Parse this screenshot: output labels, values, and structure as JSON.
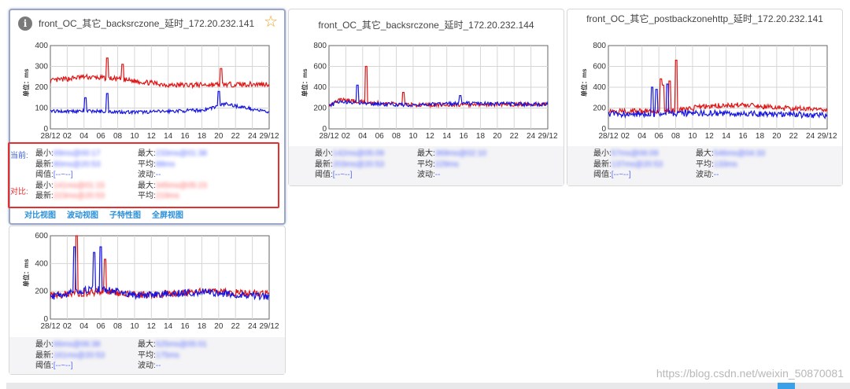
{
  "cards": [
    {
      "title": "front_OC_其它_backsrczone_延时_172.20.232.141",
      "has_info_icon": true,
      "has_star_icon": true,
      "active": true,
      "yaxis_label": "单位：ms",
      "yticks": [
        "400",
        "300",
        "200",
        "100",
        "0"
      ],
      "ymax": 400,
      "xticks": [
        "28/12",
        "02",
        "04",
        "06",
        "08",
        "10",
        "12",
        "14",
        "16",
        "18",
        "20",
        "22",
        "24",
        "29/12"
      ],
      "current_tag": "当前:",
      "compare_tag": "对比:",
      "rows": [
        {
          "l": "最小:",
          "lv": "69ms@00:17",
          "r": "最大:",
          "rv": "233ms@01:38",
          "color": "blue"
        },
        {
          "l": "最新:",
          "lv": "80ms@20:53",
          "r": "平均:",
          "rv": "88ms",
          "color": "blue"
        },
        {
          "l": "阈值:",
          "lv": "[--~--]",
          "r": "波动:",
          "rv": "--",
          "color": "plain"
        },
        {
          "l": "最小:",
          "lv": "141ms@01:15",
          "r": "最大:",
          "rv": "345ms@05:23",
          "color": "red"
        },
        {
          "l": "最新:",
          "lv": "223ms@20:53",
          "r": "平均:",
          "rv": "219ms",
          "color": "red"
        }
      ],
      "links": [
        "对比视图",
        "波动视图",
        "子特性图",
        "全屏视图"
      ]
    },
    {
      "title": "front_OC_其它_backsrczone_延时_172.20.232.144",
      "yaxis_label": "单位：ms",
      "yticks": [
        "800",
        "600",
        "400",
        "200",
        "0"
      ],
      "ymax": 800,
      "xticks": [
        "28/12",
        "02",
        "04",
        "06",
        "08",
        "10",
        "12",
        "14",
        "16",
        "18",
        "20",
        "22",
        "24",
        "29/12"
      ],
      "rows": [
        {
          "l": "最小:",
          "lv": "142ms@05:09",
          "r": "最大:",
          "rv": "369ms@02:10",
          "color": "blue"
        },
        {
          "l": "最新:",
          "lv": "203ms@20:53",
          "r": "平均:",
          "rv": "229ms",
          "color": "blue"
        },
        {
          "l": "阈值:",
          "lv": "[--~--]",
          "r": "波动:",
          "rv": "--",
          "color": "plain"
        }
      ]
    },
    {
      "title": "front_OC_其它_postbackzonehttp_延时_172.20.232.141",
      "yaxis_label": "单位：ms",
      "yticks": [
        "800",
        "600",
        "400",
        "200",
        "0"
      ],
      "ymax": 800,
      "xticks": [
        "28/12",
        "02",
        "04",
        "06",
        "08",
        "10",
        "12",
        "14",
        "16",
        "18",
        "20",
        "22",
        "24",
        "29/12"
      ],
      "rows": [
        {
          "l": "最小:",
          "lv": "57ms@06:09",
          "r": "最大:",
          "rv": "546ms@04:33",
          "color": "blue"
        },
        {
          "l": "最新:",
          "lv": "137ms@20:53",
          "r": "平均:",
          "rv": "133ms",
          "color": "blue"
        },
        {
          "l": "阈值:",
          "lv": "[--~--]",
          "r": "波动:",
          "rv": "--",
          "color": "plain"
        }
      ]
    },
    {
      "title": "",
      "yaxis_label": "单位：ms",
      "yticks": [
        "600",
        "400",
        "200",
        "0"
      ],
      "ymax": 600,
      "xticks": [
        "28/12",
        "02",
        "04",
        "06",
        "08",
        "10",
        "12",
        "14",
        "16",
        "18",
        "20",
        "22",
        "24",
        "29/12"
      ],
      "rows": [
        {
          "l": "最小:",
          "lv": "66ms@06:38",
          "r": "最大:",
          "rv": "525ms@05:01",
          "color": "blue"
        },
        {
          "l": "最新:",
          "lv": "161ms@20:53",
          "r": "平均:",
          "rv": "175ms",
          "color": "blue"
        },
        {
          "l": "阈值:",
          "lv": "[--~--]",
          "r": "波动:",
          "rv": "--",
          "color": "plain"
        }
      ]
    }
  ],
  "watermark": "https://blog.csdn.net/weixin_50870081",
  "colors": {
    "series_current": "#1515e0",
    "series_compare": "#e01515",
    "link": "#2a8fd8",
    "highlight": "#e53030"
  }
}
